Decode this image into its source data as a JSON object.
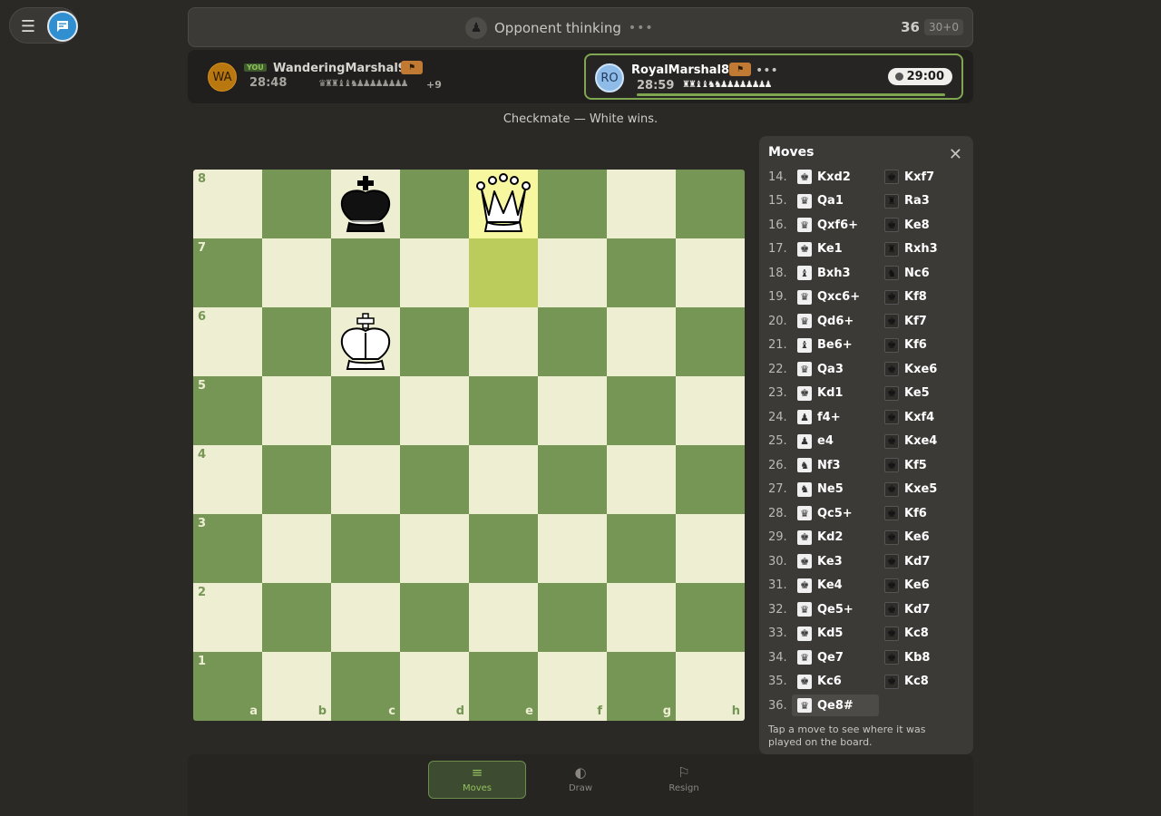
{
  "colors": {
    "accent": "#7fa650",
    "light_square": "#eeeed2",
    "dark_square": "#769656",
    "highlight": "#f7f7a0"
  },
  "status": {
    "text": "Opponent thinking",
    "dots": "•••",
    "move_count": "36",
    "time_control": "30+0",
    "icon": "pawn-icon"
  },
  "player_left": {
    "initials": "WA",
    "you_tag": "YOU",
    "name": "WanderingMarshal959",
    "time": "28:48",
    "captured": "♛♜♜♝♝♞♟♟♟♟♟♟♟♟",
    "advantage": "+9"
  },
  "player_right": {
    "initials": "RO",
    "name": "RoyalMarshal823",
    "more": "•••",
    "time": "28:59",
    "captured": "♜♜♝♝♞♞♟♟♟♟♟♟♟♟",
    "clock": "29:00"
  },
  "result": "Checkmate — White wins.",
  "board": {
    "ranks": [
      "8",
      "7",
      "6",
      "5",
      "4",
      "3",
      "2",
      "1"
    ],
    "files": [
      "a",
      "b",
      "c",
      "d",
      "e",
      "f",
      "g",
      "h"
    ],
    "pieces": [
      {
        "square": "c8",
        "piece": "black-king"
      },
      {
        "square": "e8",
        "piece": "white-queen"
      },
      {
        "square": "c6",
        "piece": "white-king"
      }
    ],
    "highlighted": [
      "e8",
      "e7"
    ]
  },
  "moves_panel": {
    "title": "Moves",
    "hint": "Tap a move to see where it was played on the board.",
    "moves": [
      {
        "n": "14.",
        "w": "Kxd2",
        "wi": "♚",
        "b": "Kxf7",
        "bi": "♚"
      },
      {
        "n": "15.",
        "w": "Qa1",
        "wi": "♛",
        "b": "Ra3",
        "bi": "♜"
      },
      {
        "n": "16.",
        "w": "Qxf6+",
        "wi": "♛",
        "b": "Ke8",
        "bi": "♚"
      },
      {
        "n": "17.",
        "w": "Ke1",
        "wi": "♚",
        "b": "Rxh3",
        "bi": "♜"
      },
      {
        "n": "18.",
        "w": "Bxh3",
        "wi": "♝",
        "b": "Nc6",
        "bi": "♞"
      },
      {
        "n": "19.",
        "w": "Qxc6+",
        "wi": "♛",
        "b": "Kf8",
        "bi": "♚"
      },
      {
        "n": "20.",
        "w": "Qd6+",
        "wi": "♛",
        "b": "Kf7",
        "bi": "♚"
      },
      {
        "n": "21.",
        "w": "Be6+",
        "wi": "♝",
        "b": "Kf6",
        "bi": "♚"
      },
      {
        "n": "22.",
        "w": "Qa3",
        "wi": "♛",
        "b": "Kxe6",
        "bi": "♚"
      },
      {
        "n": "23.",
        "w": "Kd1",
        "wi": "♚",
        "b": "Ke5",
        "bi": "♚"
      },
      {
        "n": "24.",
        "w": "f4+",
        "wi": "♟",
        "b": "Kxf4",
        "bi": "♚"
      },
      {
        "n": "25.",
        "w": "e4",
        "wi": "♟",
        "b": "Kxe4",
        "bi": "♚"
      },
      {
        "n": "26.",
        "w": "Nf3",
        "wi": "♞",
        "b": "Kf5",
        "bi": "♚"
      },
      {
        "n": "27.",
        "w": "Ne5",
        "wi": "♞",
        "b": "Kxe5",
        "bi": "♚"
      },
      {
        "n": "28.",
        "w": "Qc5+",
        "wi": "♛",
        "b": "Kf6",
        "bi": "♚"
      },
      {
        "n": "29.",
        "w": "Kd2",
        "wi": "♚",
        "b": "Ke6",
        "bi": "♚"
      },
      {
        "n": "30.",
        "w": "Ke3",
        "wi": "♚",
        "b": "Kd7",
        "bi": "♚"
      },
      {
        "n": "31.",
        "w": "Ke4",
        "wi": "♚",
        "b": "Ke6",
        "bi": "♚"
      },
      {
        "n": "32.",
        "w": "Qe5+",
        "wi": "♛",
        "b": "Kd7",
        "bi": "♚"
      },
      {
        "n": "33.",
        "w": "Kd5",
        "wi": "♚",
        "b": "Kc8",
        "bi": "♚"
      },
      {
        "n": "34.",
        "w": "Qe7",
        "wi": "♛",
        "b": "Kb8",
        "bi": "♚"
      },
      {
        "n": "35.",
        "w": "Kc6",
        "wi": "♚",
        "b": "Kc8",
        "bi": "♚"
      },
      {
        "n": "36.",
        "w": "Qe8#",
        "wi": "♛",
        "b": "",
        "bi": ""
      }
    ]
  },
  "tabs": [
    {
      "label": "Moves",
      "icon": "list-icon",
      "active": true
    },
    {
      "label": "Draw",
      "icon": "half-circle-icon",
      "active": false
    },
    {
      "label": "Resign",
      "icon": "flag-icon",
      "active": false
    }
  ]
}
